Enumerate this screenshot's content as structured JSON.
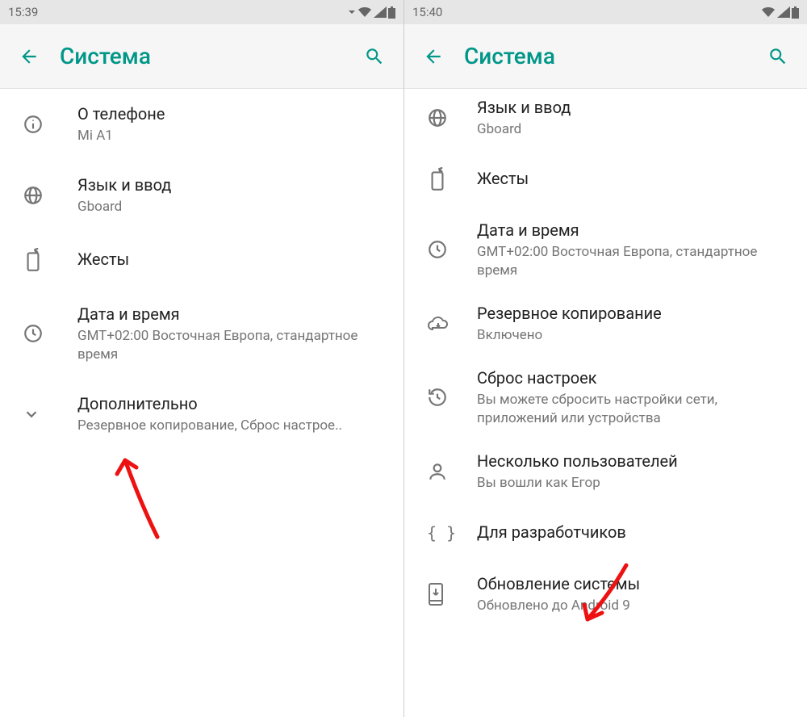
{
  "left": {
    "status_time": "15:39",
    "appbar": {
      "title": "Система"
    },
    "items": [
      {
        "id": "about",
        "title": "О телефоне",
        "subtitle": "Mi A1"
      },
      {
        "id": "lang",
        "title": "Язык и ввод",
        "subtitle": "Gboard"
      },
      {
        "id": "gestures",
        "title": "Жесты",
        "subtitle": ""
      },
      {
        "id": "datetime",
        "title": "Дата и время",
        "subtitle": "GMT+02:00 Восточная Европа, стандартное время"
      },
      {
        "id": "advanced",
        "title": "Дополнительно",
        "subtitle": "Резервное копирование, Сброс настрое.."
      }
    ]
  },
  "right": {
    "status_time": "15:40",
    "appbar": {
      "title": "Система"
    },
    "items": [
      {
        "id": "lang",
        "title": "Язык и ввод",
        "subtitle": "Gboard"
      },
      {
        "id": "gestures",
        "title": "Жесты",
        "subtitle": ""
      },
      {
        "id": "datetime",
        "title": "Дата и время",
        "subtitle": "GMT+02:00 Восточная Европа, стандартное время"
      },
      {
        "id": "backup",
        "title": "Резервное копирование",
        "subtitle": "Включено"
      },
      {
        "id": "reset",
        "title": "Сброс настроек",
        "subtitle": "Вы можете сбросить настройки сети, приложений или устройства"
      },
      {
        "id": "users",
        "title": "Несколько пользователей",
        "subtitle": "Вы вошли как Егор"
      },
      {
        "id": "dev",
        "title": "Для разработчиков",
        "subtitle": ""
      },
      {
        "id": "update",
        "title": "Обновление системы",
        "subtitle": "Обновлено до Android 9"
      }
    ]
  },
  "colors": {
    "accent": "#009688",
    "arrow": "#e11"
  }
}
